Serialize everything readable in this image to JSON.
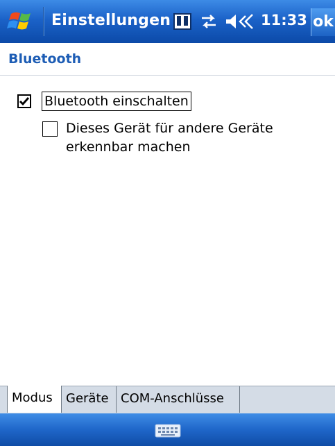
{
  "titlebar": {
    "title": "Einstellungen",
    "clock": "11:33",
    "ok_label": "ok",
    "icons": [
      "windows-start-icon",
      "device-icon",
      "connectivity-icon",
      "volume-icon"
    ]
  },
  "page": {
    "title": "Bluetooth"
  },
  "options": {
    "bluetooth_on": {
      "label": "Bluetooth einschalten",
      "checked": true
    },
    "discoverable": {
      "line1": "Dieses Gerät für andere Geräte",
      "line2": "erkennbar machen",
      "checked": false
    }
  },
  "tabs": [
    {
      "label": "Modus",
      "active": true
    },
    {
      "label": "Geräte",
      "active": false
    },
    {
      "label": "COM-Anschlüsse",
      "active": false
    }
  ],
  "menubar": {
    "icon": "keyboard-icon"
  },
  "colors": {
    "titlebar_blue": "#1b62c8",
    "header_text": "#1d5db5",
    "tab_background": "#d4dce6"
  }
}
